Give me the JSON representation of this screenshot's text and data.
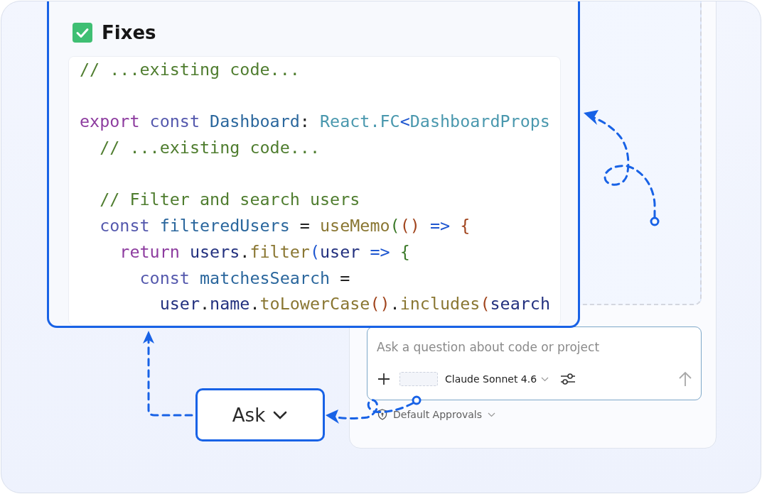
{
  "code_card": {
    "title": "Fixes",
    "code_lines": [
      {
        "kind": "code",
        "tokens": [
          {
            "text": "// ...existing code...",
            "kind": "comment"
          }
        ]
      },
      {
        "kind": "blank"
      },
      {
        "kind": "code",
        "tokens": [
          {
            "text": "export ",
            "kind": "keyword"
          },
          {
            "text": "const ",
            "kind": "storage"
          },
          {
            "text": "Dashboard",
            "kind": "name"
          },
          {
            "text": ": ",
            "kind": "plain"
          },
          {
            "text": "React.FC",
            "kind": "type"
          },
          {
            "text": "<",
            "kind": "operator"
          },
          {
            "text": "DashboardProps",
            "kind": "type"
          }
        ]
      },
      {
        "kind": "code",
        "tokens": [
          {
            "text": "  // ...existing code...",
            "kind": "comment"
          }
        ]
      },
      {
        "kind": "blank"
      },
      {
        "kind": "code",
        "tokens": [
          {
            "text": "  // Filter and search users",
            "kind": "comment"
          }
        ]
      },
      {
        "kind": "code",
        "tokens": [
          {
            "text": "  const ",
            "kind": "storage"
          },
          {
            "text": "filteredUsers",
            "kind": "name"
          },
          {
            "text": " = ",
            "kind": "plain"
          },
          {
            "text": "useMemo",
            "kind": "function"
          },
          {
            "text": "(",
            "kind": "bracket"
          },
          {
            "text": "()",
            "kind": "paren"
          },
          {
            "text": " => ",
            "kind": "operator"
          },
          {
            "text": "{",
            "kind": "paren"
          }
        ]
      },
      {
        "kind": "code",
        "tokens": [
          {
            "text": "    return ",
            "kind": "keyword"
          },
          {
            "text": "users",
            "kind": "variable"
          },
          {
            "text": ".",
            "kind": "plain"
          },
          {
            "text": "filter",
            "kind": "function"
          },
          {
            "text": "(",
            "kind": "operator"
          },
          {
            "text": "user",
            "kind": "variable"
          },
          {
            "text": " => ",
            "kind": "operator"
          },
          {
            "text": "{",
            "kind": "bracket"
          }
        ]
      },
      {
        "kind": "code",
        "tokens": [
          {
            "text": "      const ",
            "kind": "storage"
          },
          {
            "text": "matchesSearch",
            "kind": "name"
          },
          {
            "text": " =",
            "kind": "plain"
          }
        ]
      },
      {
        "kind": "code",
        "tokens": [
          {
            "text": "        user",
            "kind": "variable"
          },
          {
            "text": ".",
            "kind": "plain"
          },
          {
            "text": "name",
            "kind": "variable"
          },
          {
            "text": ".",
            "kind": "plain"
          },
          {
            "text": "toLowerCase",
            "kind": "function"
          },
          {
            "text": "()",
            "kind": "paren"
          },
          {
            "text": ".",
            "kind": "plain"
          },
          {
            "text": "includes",
            "kind": "function"
          },
          {
            "text": "(",
            "kind": "paren"
          },
          {
            "text": "search",
            "kind": "variable"
          }
        ]
      }
    ]
  },
  "mode_button": {
    "label": "Ask"
  },
  "composer": {
    "placeholder": "Ask a question about code or project",
    "model": "Claude Sonnet 4.6",
    "approvals": "Default Approvals"
  }
}
